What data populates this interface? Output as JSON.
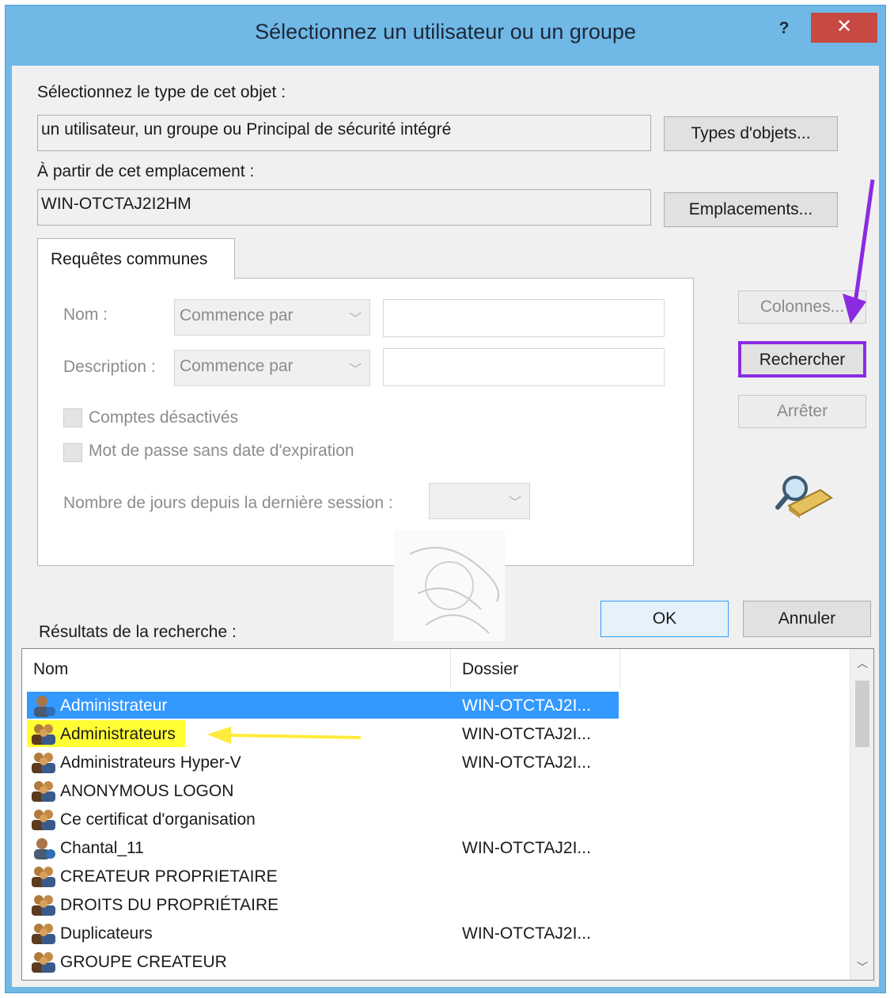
{
  "window": {
    "title": "Sélectionnez un utilisateur ou un groupe",
    "help_label": "?",
    "close_label": "✕"
  },
  "object_type": {
    "label": "Sélectionnez le type de cet objet :",
    "value": "un utilisateur, un groupe ou Principal de sécurité intégré",
    "button": "Types d'objets..."
  },
  "location": {
    "label": "À partir de cet emplacement :",
    "value": "WIN-OTCTAJ2I2HM",
    "button": "Emplacements..."
  },
  "query": {
    "tab_label": "Requêtes communes",
    "name_label": "Nom :",
    "name_match": "Commence par",
    "description_label": "Description :",
    "description_match": "Commence par",
    "disabled_accounts": "Comptes désactivés",
    "no_expire_password": "Mot de passe sans date d'expiration",
    "days_label": "Nombre de jours depuis la dernière session :"
  },
  "side_buttons": {
    "columns": "Colonnes...",
    "search": "Rechercher",
    "stop": "Arrêter"
  },
  "dialog_buttons": {
    "ok": "OK",
    "cancel": "Annuler"
  },
  "results": {
    "label": "Résultats de la recherche :",
    "columns": [
      "Nom",
      "Dossier"
    ],
    "rows": [
      {
        "name": "Administrateur",
        "folder": "WIN-OTCTAJ2I...",
        "icon": "user-icon",
        "selected": true
      },
      {
        "name": "Administrateurs",
        "folder": "WIN-OTCTAJ2I...",
        "icon": "group-icon",
        "highlighted": true
      },
      {
        "name": "Administrateurs Hyper-V",
        "folder": "WIN-OTCTAJ2I...",
        "icon": "group-icon"
      },
      {
        "name": "ANONYMOUS LOGON",
        "folder": "",
        "icon": "group-icon"
      },
      {
        "name": "Ce certificat d'organisation",
        "folder": "",
        "icon": "group-icon"
      },
      {
        "name": "Chantal_11",
        "folder": "WIN-OTCTAJ2I...",
        "icon": "user-icon"
      },
      {
        "name": "CREATEUR PROPRIETAIRE",
        "folder": "",
        "icon": "group-icon"
      },
      {
        "name": "DROITS DU PROPRIÉTAIRE",
        "folder": "",
        "icon": "group-icon"
      },
      {
        "name": "Duplicateurs",
        "folder": "WIN-OTCTAJ2I...",
        "icon": "group-icon"
      },
      {
        "name": "GROUPE CREATEUR",
        "folder": "",
        "icon": "group-icon"
      }
    ]
  },
  "colors": {
    "title_bar": "#70b8e6",
    "close_button": "#c74a42",
    "selection": "#3399ff",
    "highlight": "#ffff33",
    "annotation_purple": "#8a2be2",
    "annotation_yellow": "#ffeb3b"
  }
}
